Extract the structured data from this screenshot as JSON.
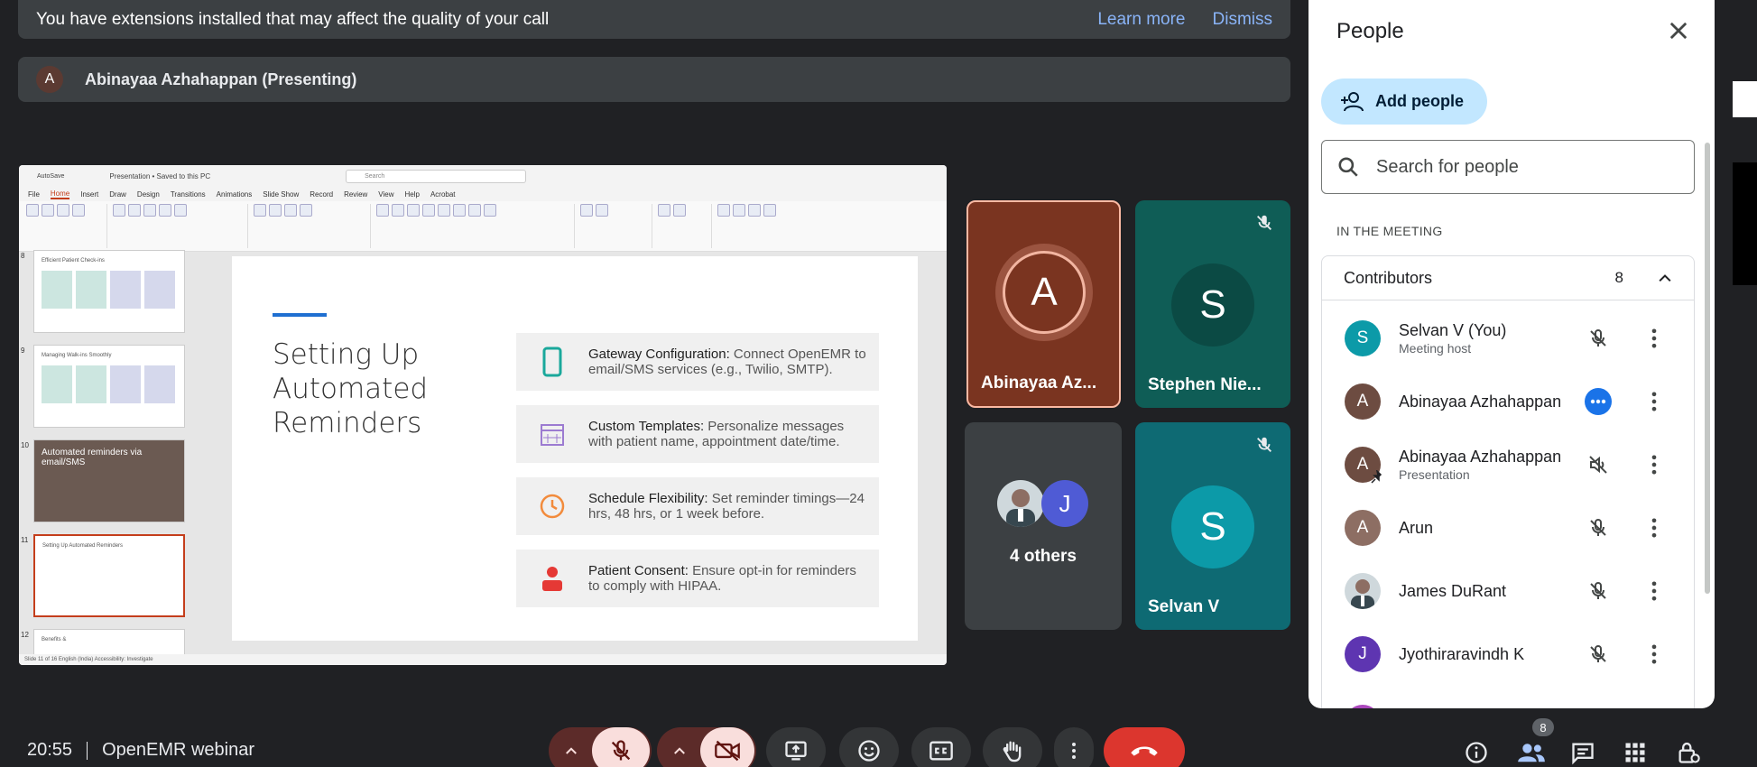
{
  "banner": {
    "text": "You have extensions installed that may affect the quality of your call",
    "learn_more": "Learn more",
    "dismiss": "Dismiss"
  },
  "presenter": {
    "initial": "A",
    "label": "Abinayaa Azhahappan (Presenting)"
  },
  "slide": {
    "title": "Setting Up Automated Reminders",
    "cards": [
      {
        "head": "Gateway Configuration:",
        "body": " Connect OpenEMR to email/SMS services (e.g., Twilio, SMTP).",
        "icon": "phone-icon"
      },
      {
        "head": "Custom Templates:",
        "body": " Personalize messages with patient name, appointment date/time.",
        "icon": "calendar-icon"
      },
      {
        "head": "Schedule Flexibility:",
        "body": " Set reminder timings—24 hrs, 48 hrs, or 1 week before.",
        "icon": "clock-icon"
      },
      {
        "head": "Patient Consent:",
        "body": " Ensure opt-in for reminders to comply with HIPAA.",
        "icon": "person-icon"
      }
    ],
    "thumbs": [
      {
        "num": "8",
        "title": "Efficient Patient Check-ins"
      },
      {
        "num": "9",
        "title": "Managing Walk-ins Smoothly"
      },
      {
        "num": "10",
        "title": "Automated reminders via email/SMS"
      },
      {
        "num": "11",
        "title": "Setting Up Automated Reminders"
      },
      {
        "num": "12",
        "title": "Benefits &"
      }
    ],
    "menu": [
      "File",
      "Home",
      "Insert",
      "Draw",
      "Design",
      "Transitions",
      "Animations",
      "Slide Show",
      "Record",
      "Review",
      "View",
      "Help",
      "Acrobat"
    ],
    "doc_title": "Presentation • Saved to this PC",
    "search": "Search",
    "status": "Slide 11 of 16   English (India)   Accessibility: Investigate"
  },
  "tiles": [
    {
      "initial": "A",
      "name": "Abinayaa Az...",
      "color": "#7a3420"
    },
    {
      "initial": "S",
      "name": "Stephen Nie...",
      "color": "#0d5c55"
    },
    {
      "label": "4 others",
      "j_initial": "J"
    },
    {
      "initial": "S",
      "name": "Selvan V",
      "color": "#0c9aa8"
    }
  ],
  "panel": {
    "title": "People",
    "add_people": "Add people",
    "search_placeholder": "Search for people",
    "section": "IN THE MEETING",
    "contributors": "Contributors",
    "count": "8",
    "people": [
      {
        "initial": "S",
        "name": "Selvan V (You)",
        "sub": "Meeting host",
        "color": "#0c9aa8",
        "mic": "mic-off-icon"
      },
      {
        "initial": "A",
        "name": "Abinayaa Azhahappan",
        "sub": "",
        "color": "#6d4c41",
        "mic": "speaking-icon"
      },
      {
        "initial": "A",
        "name": "Abinayaa Azhahappan",
        "sub": "Presentation",
        "color": "#6d4c41",
        "mic": "volume-off-icon"
      },
      {
        "initial": "A",
        "name": "Arun",
        "sub": "",
        "color": "#8d6e63",
        "mic": "mic-off-icon"
      },
      {
        "initial": "",
        "name": "James DuRant",
        "sub": "",
        "color": "#9e9e9e",
        "mic": "mic-off-icon"
      },
      {
        "initial": "J",
        "name": "Jyothiraravindh K",
        "sub": "",
        "color": "#5e35b1",
        "mic": "mic-off-icon"
      }
    ]
  },
  "bottom": {
    "time": "20:55",
    "meeting": "OpenEMR webinar",
    "people_badge": "8"
  }
}
